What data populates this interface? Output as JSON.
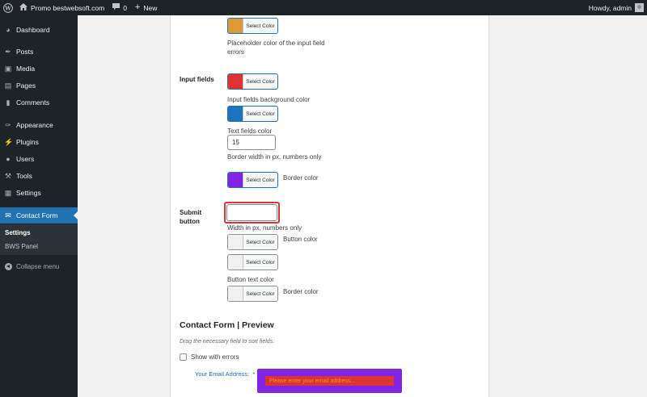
{
  "adminbar": {
    "site_name": "Promo bestwebsoft.com",
    "comments_count": "0",
    "new_label": "New",
    "howdy": "Howdy, admin"
  },
  "sidebar": {
    "items": [
      {
        "label": "Dashboard",
        "icon": "dashboard-icon"
      },
      {
        "label": "Posts",
        "icon": "pin-icon"
      },
      {
        "label": "Media",
        "icon": "media-icon"
      },
      {
        "label": "Pages",
        "icon": "pages-icon"
      },
      {
        "label": "Comments",
        "icon": "comments-icon"
      },
      {
        "label": "Appearance",
        "icon": "brush-icon"
      },
      {
        "label": "Plugins",
        "icon": "plugin-icon"
      },
      {
        "label": "Users",
        "icon": "users-icon"
      },
      {
        "label": "Tools",
        "icon": "wrench-icon"
      },
      {
        "label": "Settings",
        "icon": "settings-icon"
      },
      {
        "label": "Contact Form",
        "icon": "envelope-icon"
      }
    ],
    "submenu": [
      "Settings",
      "BWS Panel"
    ],
    "collapse_label": "Collapse menu"
  },
  "form": {
    "select_color_label": "Select Color",
    "placeholder_errors_desc": "Placeholder color of the input field errors",
    "input_fields_label": "Input fields",
    "input_bg_desc": "Input fields background color",
    "text_fields_desc": "Text fields color",
    "border_width_value": "15",
    "border_width_desc": "Border width in px, numbers only",
    "border_color_desc": "Border color",
    "submit_button_label": "Submit button",
    "submit_width_value": "",
    "submit_width_desc": "Width in px, numbers only",
    "button_color_desc": "Button color",
    "button_text_color_desc": "Button text color",
    "submit_border_color_desc": "Border color"
  },
  "colors": {
    "placeholder_errors": "#dd9933",
    "input_bg": "#dd3333",
    "text_fields": "#1e73be",
    "border": "#8224e3",
    "button": "#f0f0f1",
    "button_text": "#f0f0f1",
    "button_border": "#f0f0f1",
    "accent": "#2271b1",
    "highlight": "#d63638"
  },
  "preview": {
    "title": "Contact Form | Preview",
    "hint": "Drag the necessary field to sort fields.",
    "show_errors_label": "Show with errors",
    "email_label": "Your Email Address:",
    "required_mark": "*",
    "email_placeholder": "Please enter your email address..."
  }
}
